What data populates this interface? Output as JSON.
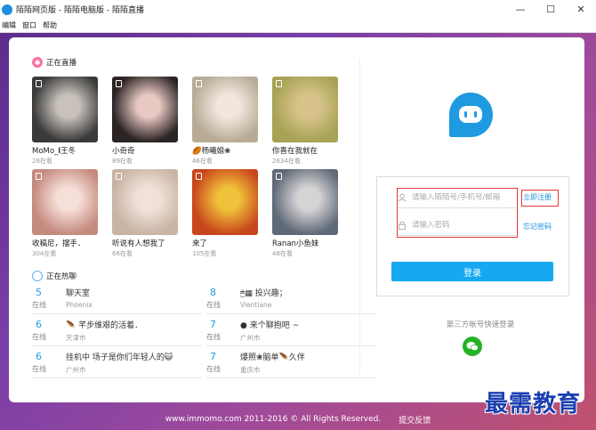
{
  "window": {
    "title": "陌陌网页版 - 陌陌电脑版 - 陌陌直播",
    "controls": [
      "—",
      "☐",
      "✕"
    ]
  },
  "menu": [
    {
      "label": "编辑"
    },
    {
      "label": "窗口"
    },
    {
      "label": "帮助"
    }
  ],
  "live": {
    "heading": "正在直播",
    "cards": [
      {
        "name": "MoMo_𝐈王冬",
        "count": "28在看",
        "colors": [
          "#3a3a3a",
          "#c9c2bc"
        ]
      },
      {
        "name": "小奇奇",
        "count": "89在看",
        "colors": [
          "#2b2424",
          "#e8c8c3"
        ]
      },
      {
        "name": "🏉杨曦娘❀",
        "count": "46在看",
        "colors": [
          "#b7ab95",
          "#f2e7df"
        ]
      },
      {
        "name": "你喜在我就在",
        "count": "2634在看",
        "colors": [
          "#a7a254",
          "#d7c38a"
        ]
      },
      {
        "name": "收稿尼，摆手．",
        "count": "304在看",
        "colors": [
          "#c58a7e",
          "#f6dfd8"
        ]
      },
      {
        "name": "听说有人想我了",
        "count": "66在看",
        "colors": [
          "#c9b4a4",
          "#f0e1da"
        ]
      },
      {
        "name": "来了",
        "count": "105在看",
        "colors": [
          "#c8461b",
          "#f0c13a"
        ]
      },
      {
        "name": "Ranan小鱼妹",
        "count": "48在看",
        "colors": [
          "#5f6a78",
          "#d6d3d5"
        ]
      }
    ]
  },
  "chat": {
    "heading": "正在热聊",
    "unit": "在线",
    "rows": [
      {
        "num": "5",
        "title": "聊天室",
        "loc": "Phoenix"
      },
      {
        "num": "8",
        "title": "🖱▦ 投兴趣；",
        "loc": "Vientiane"
      },
      {
        "num": "6",
        "title": "🪶 芊步维艰的活着．",
        "loc": "天津市"
      },
      {
        "num": "7",
        "title": "● 来个聊抱吧 ~",
        "loc": "广州市"
      },
      {
        "num": "6",
        "title": "挂机中 场子是你们年轻人的😺",
        "loc": "广州市"
      },
      {
        "num": "7",
        "title": "爆照❀脑单🪶久伴",
        "loc": "重庆市"
      }
    ]
  },
  "login": {
    "account_placeholder": "请输入陌陌号/手机号/邮箱",
    "password_placeholder": "请输入密码",
    "register_link": "立即注册",
    "forgot_link": "忘记密码",
    "login_button": "登录",
    "third_party_label": "第三方帐号快速登录"
  },
  "footer": {
    "copyright": "www.immomo.com 2011-2016 © All Rights Reserved.",
    "feedback": "提交反馈"
  },
  "watermark": "最需教育",
  "colors": {
    "accent": "#16a9f2",
    "link": "#1e8fe0",
    "highlight": "#e03a3a",
    "wechat": "#24b324"
  }
}
